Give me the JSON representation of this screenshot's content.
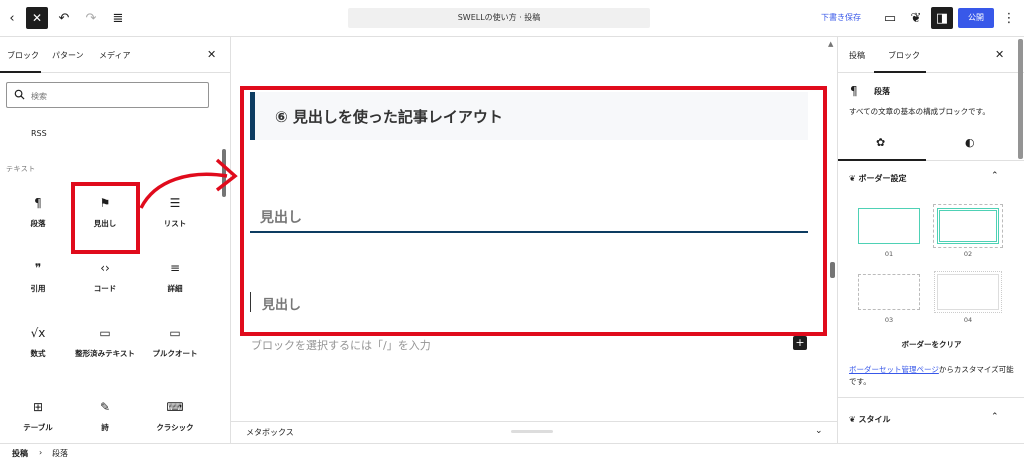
{
  "topbar": {
    "title": "SWELLの使い方 · 投稿",
    "save_draft": "下書き保存",
    "publish": "公開"
  },
  "left_panel": {
    "tabs": [
      "ブロック",
      "パターン",
      "メディア"
    ],
    "search_placeholder": "検索",
    "rss_label": "RSS",
    "category_text": "テキスト",
    "blocks": [
      {
        "label": "段落",
        "icon": "paragraph-icon",
        "glyph": "¶"
      },
      {
        "label": "見出し",
        "icon": "bookmark-icon",
        "glyph": "⚑"
      },
      {
        "label": "リスト",
        "icon": "list-icon",
        "glyph": "☰"
      },
      {
        "label": "引用",
        "icon": "quote-icon",
        "glyph": "❞"
      },
      {
        "label": "コード",
        "icon": "code-icon",
        "glyph": "‹›"
      },
      {
        "label": "詳細",
        "icon": "details-icon",
        "glyph": "≡"
      },
      {
        "label": "数式",
        "icon": "math-icon",
        "glyph": "√x"
      },
      {
        "label": "整形済みテキスト",
        "icon": "preformatted-icon",
        "glyph": "▭"
      },
      {
        "label": "プルクオート",
        "icon": "pullquote-icon",
        "glyph": "▭"
      },
      {
        "label": "テーブル",
        "icon": "table-icon",
        "glyph": "⊞"
      },
      {
        "label": "詩",
        "icon": "verse-icon",
        "glyph": "✎"
      },
      {
        "label": "クラシック",
        "icon": "keyboard-icon",
        "glyph": "⌨"
      }
    ]
  },
  "canvas": {
    "heading1": "⑥ 見出しを使った記事レイアウト",
    "heading2": "見出し",
    "heading3": "見出し",
    "placeholder": "ブロックを選択するには「/」を入力"
  },
  "metabox": {
    "label": "メタボックス"
  },
  "right_panel": {
    "tabs": [
      "投稿",
      "ブロック"
    ],
    "block_title": "段落",
    "block_desc": "すべての文章の基本の構成ブロックです。",
    "border_section": "ボーダー設定",
    "presets": [
      "01",
      "02",
      "03",
      "04"
    ],
    "clear_label": "ボーダーをクリア",
    "link_text": "ボーダーセット管理ページ",
    "link_suffix": "からカスタマイズ可能です。",
    "style_section": "スタイル"
  },
  "breadcrumb": {
    "items": [
      "投稿",
      "段落"
    ]
  },
  "colors": {
    "accent": "#3858e9",
    "highlight": "#e00b1c",
    "heading_border": "#0d3c61"
  }
}
